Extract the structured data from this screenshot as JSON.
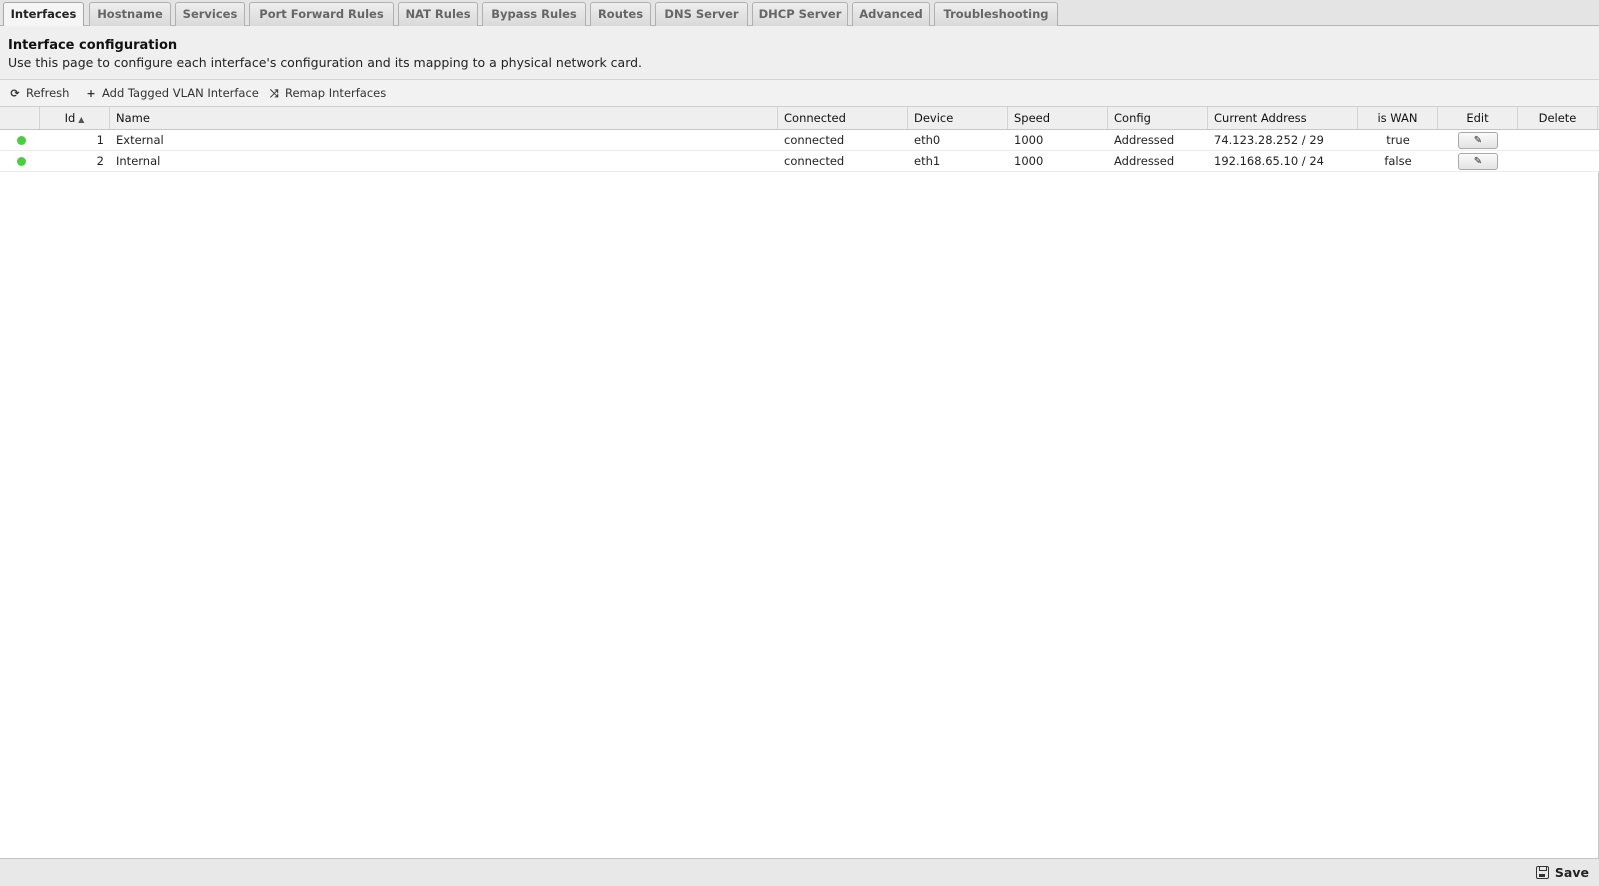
{
  "tabs": [
    {
      "label": "Interfaces",
      "active": true
    },
    {
      "label": "Hostname"
    },
    {
      "label": "Services"
    },
    {
      "label": "Port Forward Rules"
    },
    {
      "label": "NAT Rules"
    },
    {
      "label": "Bypass Rules"
    },
    {
      "label": "Routes"
    },
    {
      "label": "DNS Server"
    },
    {
      "label": "DHCP Server"
    },
    {
      "label": "Advanced"
    },
    {
      "label": "Troubleshooting"
    }
  ],
  "header": {
    "title": "Interface configuration",
    "description": "Use this page to configure each interface's configuration and its mapping to a physical network card."
  },
  "toolbar": {
    "refresh_label": "Refresh",
    "add_vlan_label": "Add Tagged VLAN Interface",
    "remap_label": "Remap Interfaces"
  },
  "grid": {
    "columns": {
      "id": "Id",
      "name": "Name",
      "connected": "Connected",
      "device": "Device",
      "speed": "Speed",
      "config": "Config",
      "current_address": "Current Address",
      "is_wan": "is WAN",
      "edit": "Edit",
      "delete": "Delete"
    },
    "sort": {
      "column": "Id",
      "direction": "ascending"
    },
    "status_color": "#4ccc3f",
    "rows": [
      {
        "id": "1",
        "name": "External",
        "connected": "connected",
        "device": "eth0",
        "speed": "1000",
        "config": "Addressed",
        "current_address": "74.123.28.252 / 29",
        "is_wan": "true"
      },
      {
        "id": "2",
        "name": "Internal",
        "connected": "connected",
        "device": "eth1",
        "speed": "1000",
        "config": "Addressed",
        "current_address": "192.168.65.10 / 24",
        "is_wan": "false"
      }
    ]
  },
  "footer": {
    "save_label": "Save"
  },
  "icons": {
    "refresh": "refresh-icon",
    "add": "plus-icon",
    "remap": "shuffle-icon",
    "edit": "pencil-icon",
    "save": "floppy-disk-icon",
    "sort": "sort-ascending-icon"
  }
}
